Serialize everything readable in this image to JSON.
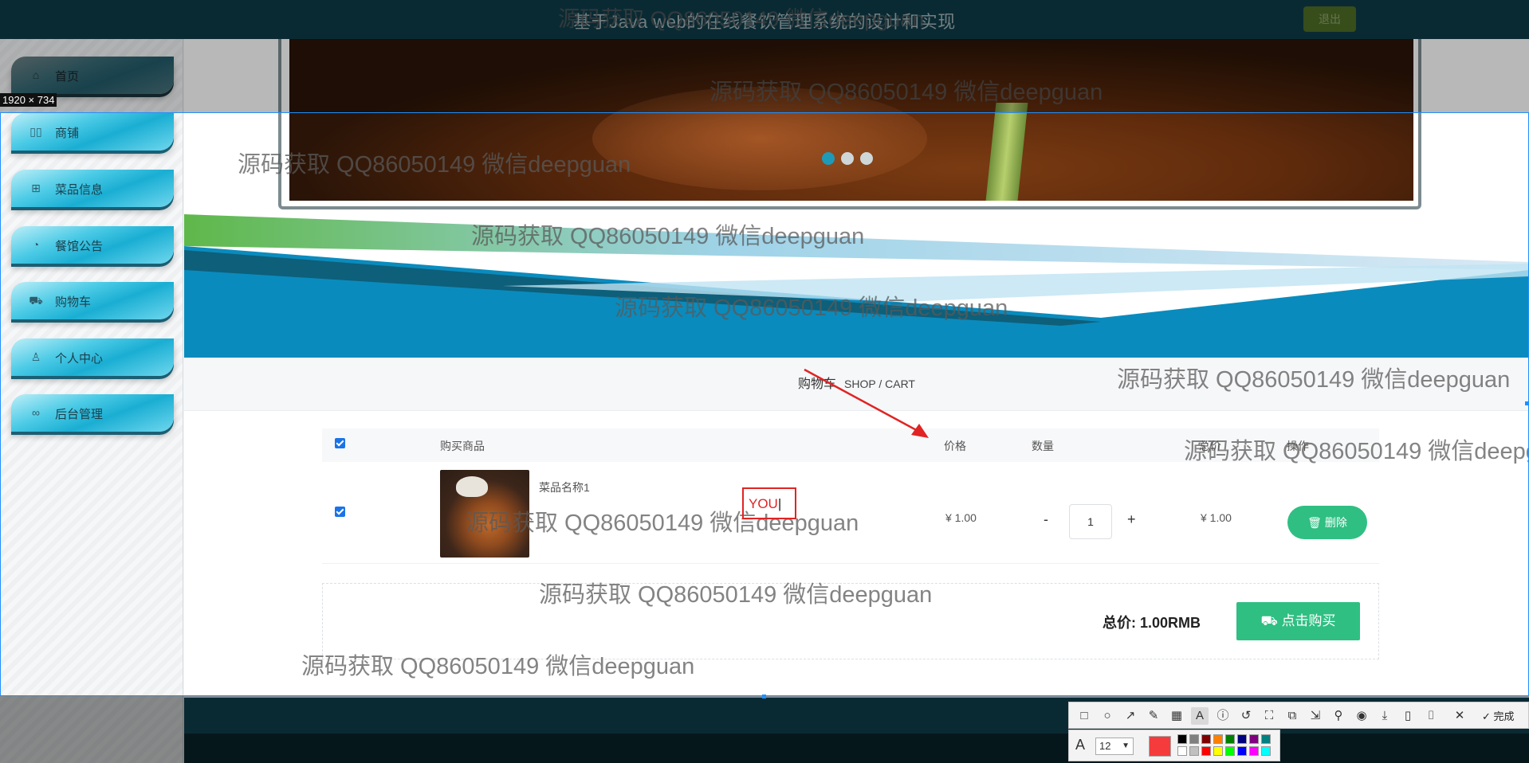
{
  "app": {
    "title": "基于Java web的在线餐饮管理系统的设计和实现",
    "logout_label": "退出"
  },
  "sidebar": {
    "items": [
      {
        "label": "首页",
        "icon": "home-icon"
      },
      {
        "label": "商铺",
        "icon": "shop-icon"
      },
      {
        "label": "菜品信息",
        "icon": "menu-icon"
      },
      {
        "label": "餐馆公告",
        "icon": "notice-icon"
      },
      {
        "label": "购物车",
        "icon": "cart-icon"
      },
      {
        "label": "个人中心",
        "icon": "user-icon"
      },
      {
        "label": "后台管理",
        "icon": "link-icon"
      }
    ]
  },
  "breadcrumb": {
    "cn": "购物车",
    "en": "SHOP / CART"
  },
  "cart": {
    "columns": [
      "购买商品",
      "价格",
      "数量",
      "总价",
      "操作"
    ],
    "rows": [
      {
        "name": "菜品名称1",
        "price": "¥ 1.00",
        "quantity": "1",
        "total": "¥ 1.00",
        "delete_label": "删除"
      }
    ],
    "summary_label": "总价:",
    "summary_value": "1.00RMB",
    "buy_label": "点击购买"
  },
  "watermark_text": "源码获取 QQ86050149 微信deepguan",
  "screenshot_tool": {
    "size_label": "1920 × 734",
    "annotation_text": "YOU",
    "done_label": "完成",
    "font_size": "12",
    "current_color": "#f53b3b",
    "palette": [
      "#000000",
      "#808080",
      "#800000",
      "#ff8000",
      "#008000",
      "#000080",
      "#800080",
      "#008080",
      "#ffffff",
      "#c0c0c0",
      "#ff0000",
      "#ffff00",
      "#00ff00",
      "#0000ff",
      "#ff00ff",
      "#00ffff"
    ]
  },
  "colors": {
    "accent_green": "#2fbf82",
    "header_bg": "#0e3b47",
    "footer_bg": "#134e5d",
    "nav_cyan": "#1aaed3"
  }
}
